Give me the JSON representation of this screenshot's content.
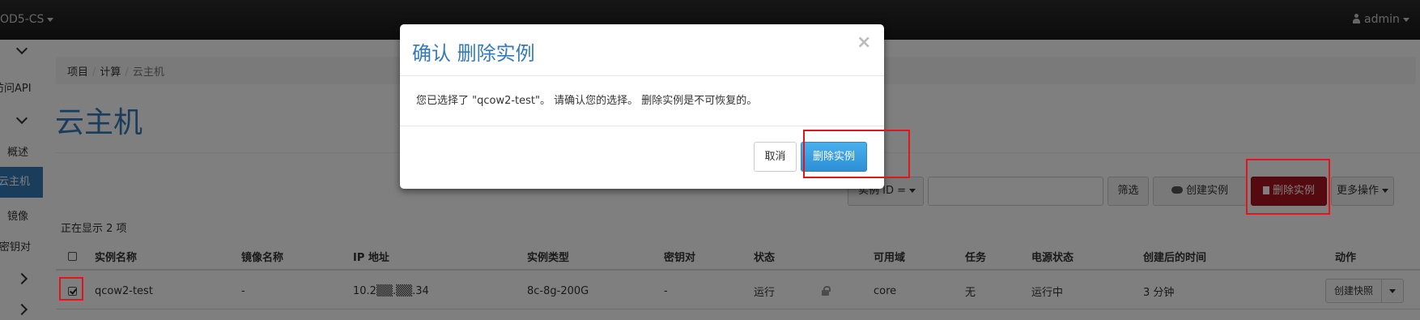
{
  "navbar": {
    "project": "OD5-CS",
    "user": "admin"
  },
  "sidebar": {
    "api_access": "访问API",
    "overview": "概述",
    "instances": "云主机",
    "images": "镜像",
    "key_pairs": "密钥对"
  },
  "breadcrumb": [
    "项目",
    "计算",
    "云主机"
  ],
  "page": {
    "title": "云主机"
  },
  "toolbar": {
    "filter_select": "实例 ID =",
    "filter_value": "",
    "filter_button": "筛选",
    "create_button": "创建实例",
    "delete_button": "删除实例",
    "more_actions": "更多操作"
  },
  "table": {
    "count_text": "正在显示 2 项",
    "headers": [
      "实例名称",
      "镜像名称",
      "IP 地址",
      "实例类型",
      "密钥对",
      "状态",
      "可用域",
      "任务",
      "电源状态",
      "创建后的时间",
      "动作"
    ],
    "rows": [
      {
        "checked": true,
        "name": "qcow2-test",
        "image": "-",
        "ip": "10.2▒▒.▒▒.34",
        "flavor": "8c-8g-200G",
        "key_pair": "-",
        "status": "运行",
        "zone": "core",
        "task": "无",
        "power": "运行中",
        "age": "3 分钟",
        "action": "创建快照"
      }
    ]
  },
  "modal": {
    "title": "确认 删除实例",
    "body": "您已选择了 \"qcow2-test\"。 请确认您的选择。 删除实例是不可恢复的。",
    "cancel": "取消",
    "submit": "删除实例"
  },
  "colors": {
    "navbar": "#1f1f1f",
    "primary": "#337ab7",
    "danger": "#a9141c",
    "annotation": "#e0161b"
  }
}
